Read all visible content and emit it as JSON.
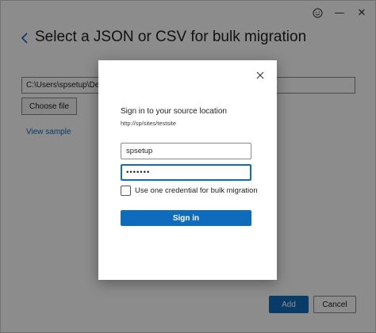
{
  "window": {
    "controls": {
      "feedback_icon": "smiley-icon",
      "minimize_glyph": "—",
      "close_glyph": "✕"
    }
  },
  "page": {
    "title": "Select a JSON or CSV for bulk migration",
    "path_value": "C:\\Users\\spsetup\\Deskto",
    "choose_file_label": "Choose file",
    "view_sample_label": "View sample",
    "add_label": "Add",
    "cancel_label": "Cancel"
  },
  "dialog": {
    "title": "Sign in to your source location",
    "url": "http://sp/sites/testsite",
    "username_value": "spsetup",
    "password_value": "•••••••",
    "checkbox_label": "Use one credential for bulk migration",
    "checkbox_checked": false,
    "sign_in_label": "Sign in"
  },
  "colors": {
    "accent": "#0f6cbd",
    "overlay": "rgba(0,0,0,0.45)"
  }
}
